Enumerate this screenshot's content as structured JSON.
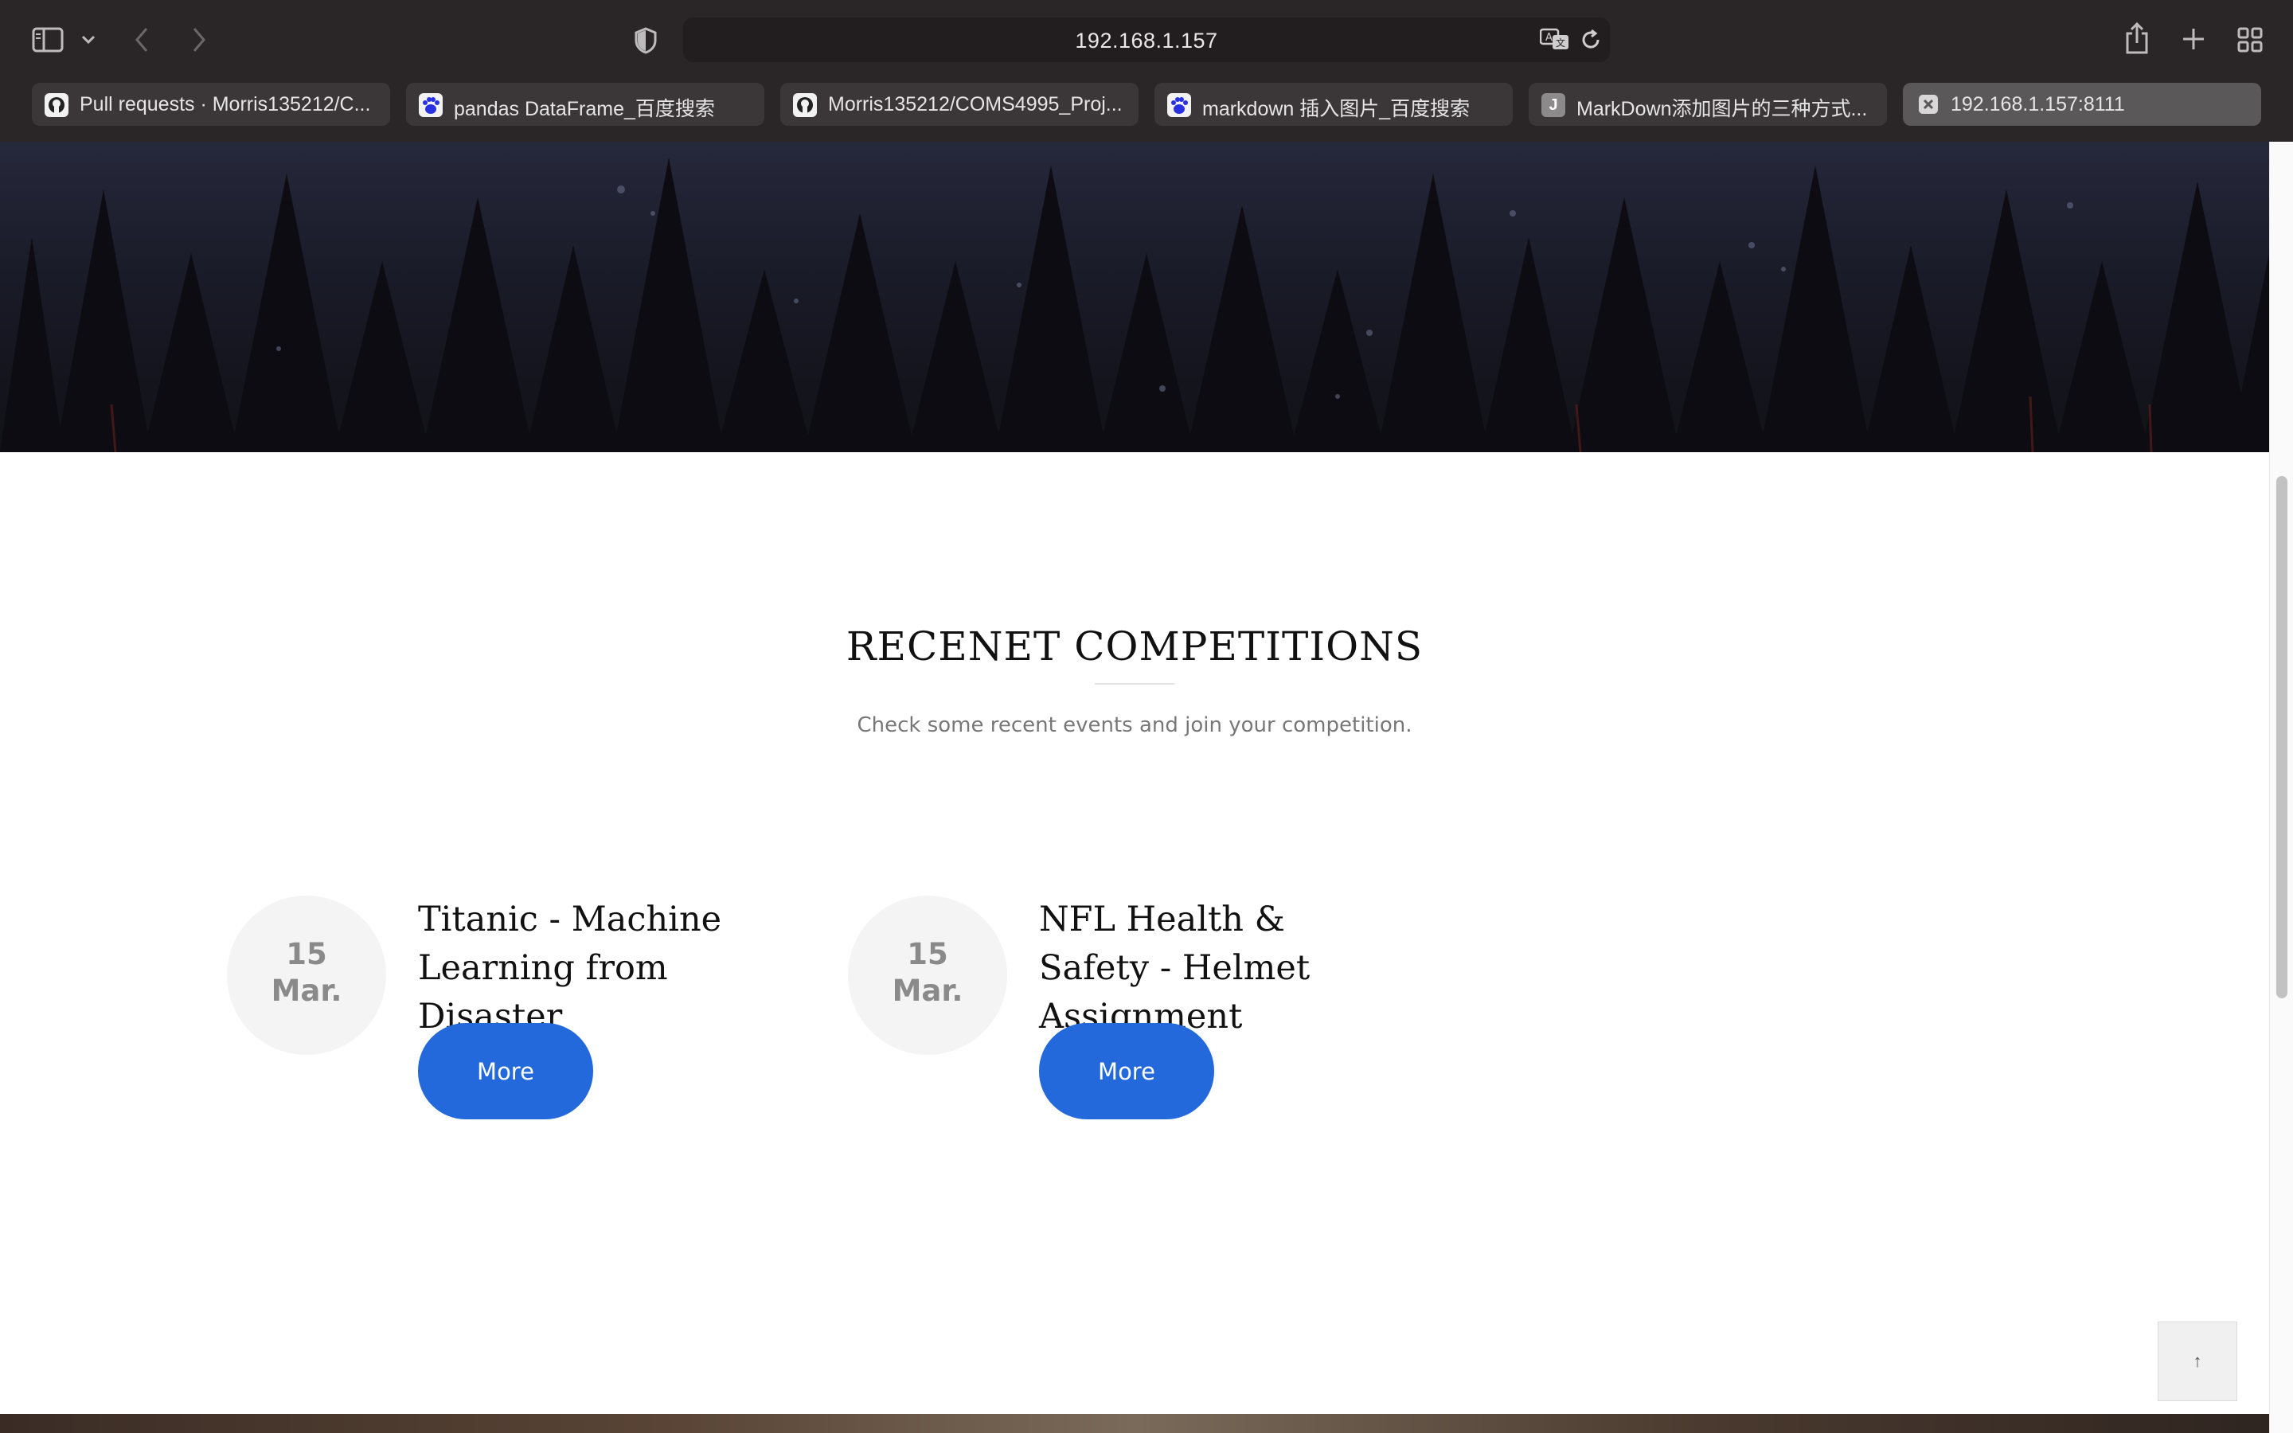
{
  "browser": {
    "address": "192.168.1.157",
    "tabs": [
      {
        "title": "Pull requests · Morris135212/C...",
        "favicon": "github-icon",
        "active": false
      },
      {
        "title": "pandas DataFrame_百度搜索",
        "favicon": "baidu-paw-icon",
        "active": false
      },
      {
        "title": "Morris135212/COMS4995_Proj...",
        "favicon": "github-icon",
        "active": false
      },
      {
        "title": "markdown 插入图片_百度搜索",
        "favicon": "baidu-paw-icon",
        "active": false
      },
      {
        "title": "MarkDown添加图片的三种方式...",
        "favicon": "letter-j-icon",
        "favicon_letter": "J",
        "active": false
      },
      {
        "title": "192.168.1.157:8111",
        "favicon": "close-icon",
        "active": true
      }
    ],
    "toolbar_icons": [
      "sidebar-icon",
      "chevron-down-icon",
      "back-icon",
      "forward-icon",
      "privacy-shield-icon",
      "translate-icon",
      "reload-icon",
      "share-icon",
      "new-tab-icon",
      "tab-overview-icon"
    ]
  },
  "page": {
    "section_title": "RECENET COMPETITIONS",
    "section_subtitle": "Check some recent events and join your competition.",
    "competitions": [
      {
        "day": "15",
        "month": "Mar.",
        "title": "Titanic - Machine Learning from Disaster",
        "button": "More"
      },
      {
        "day": "15",
        "month": "Mar.",
        "title": "NFL Health & Safety - Helmet Assignment",
        "button": "More"
      }
    ],
    "back_to_top": "↑"
  },
  "colors": {
    "chrome_bg": "#2a2627",
    "button_blue": "#2469dc",
    "date_circle": "#f4f4f4"
  }
}
